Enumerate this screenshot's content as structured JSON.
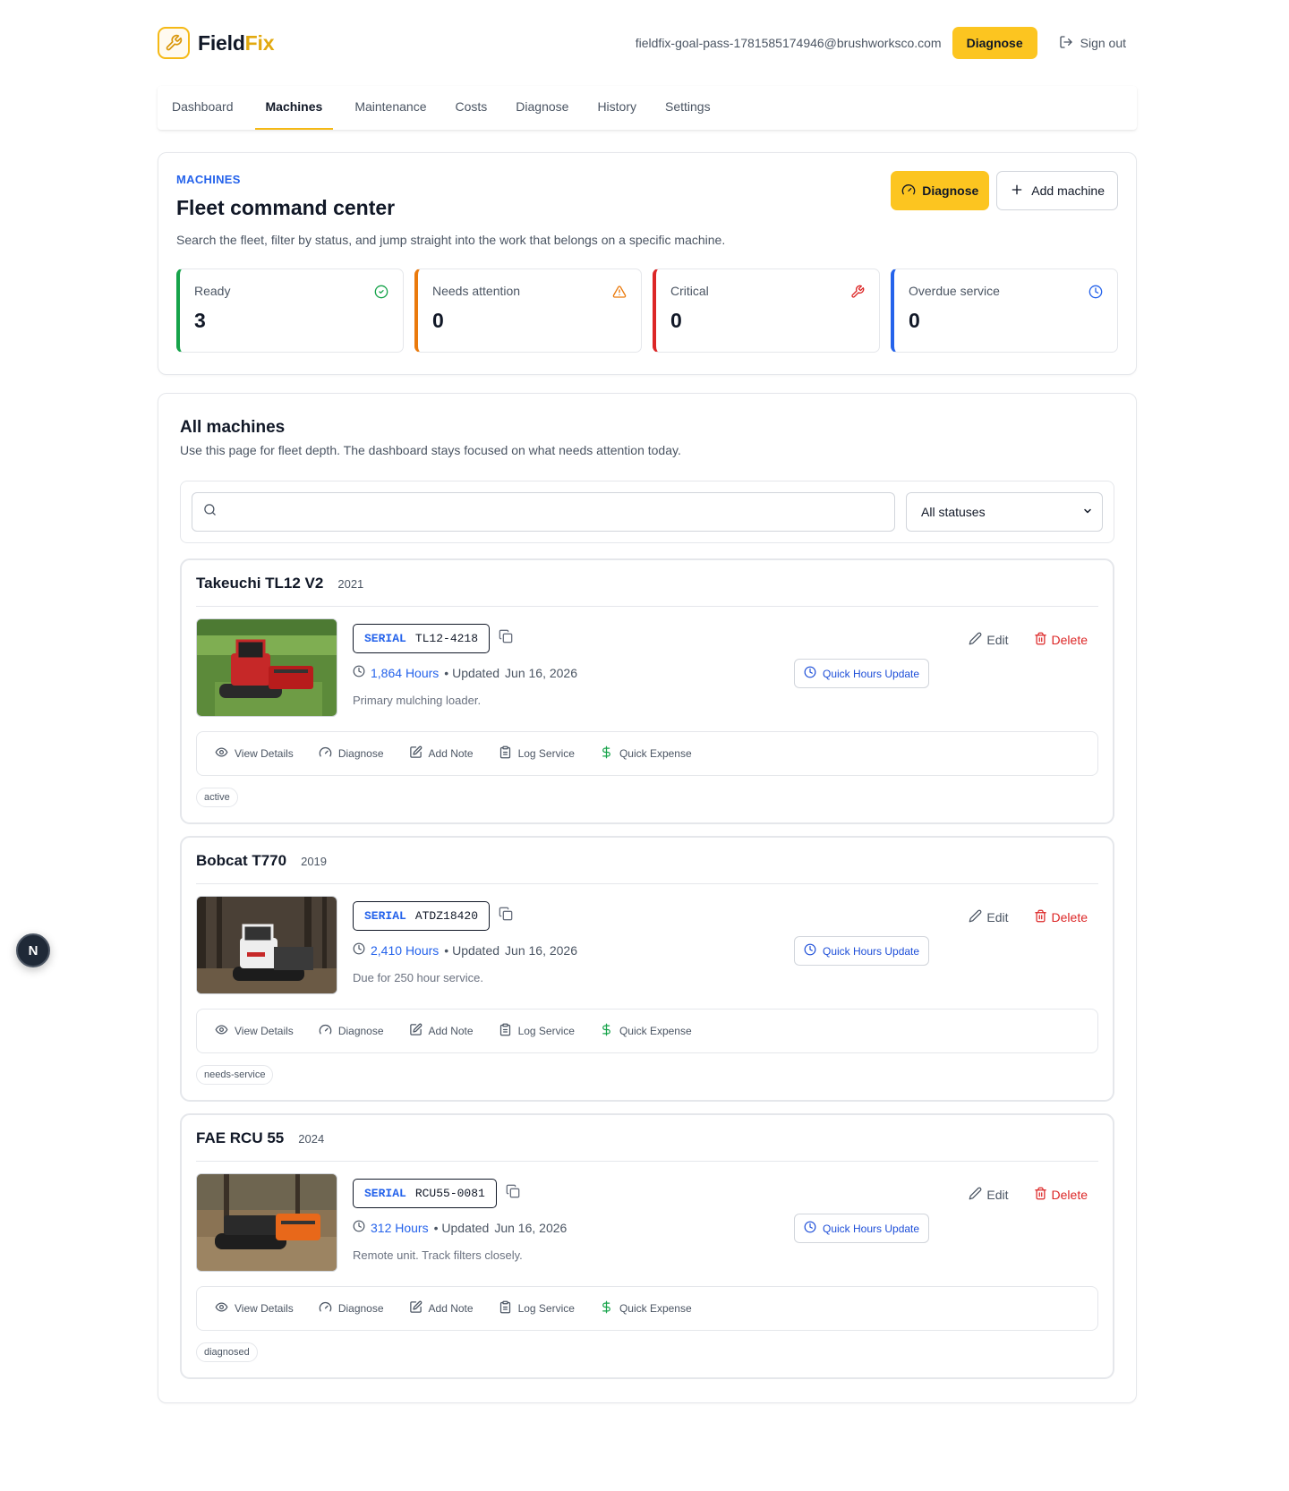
{
  "brand": {
    "name_main": "Field",
    "name_accent": "Fix"
  },
  "header": {
    "email": "fieldfix-goal-pass-1781585174946@brushworksco.com",
    "diagnose_label": "Diagnose",
    "signout_label": "Sign out"
  },
  "nav": {
    "items": [
      "Dashboard",
      "Machines",
      "Maintenance",
      "Costs",
      "Diagnose",
      "History",
      "Settings"
    ],
    "active": "Machines"
  },
  "hero": {
    "eyebrow": "MACHINES",
    "title": "Fleet command center",
    "subtitle": "Search the fleet, filter by status, and jump straight into the work that belongs on a specific machine.",
    "diagnose_label": "Diagnose",
    "add_label": "Add machine"
  },
  "stats": [
    {
      "label": "Ready",
      "value": "3",
      "color": "#16a34a"
    },
    {
      "label": "Needs attention",
      "value": "0",
      "color": "#ea7a0c"
    },
    {
      "label": "Critical",
      "value": "0",
      "color": "#dc2626"
    },
    {
      "label": "Overdue service",
      "value": "0",
      "color": "#2563eb"
    }
  ],
  "list": {
    "title": "All machines",
    "subtitle": "Use this page for fleet depth. The dashboard stays focused on what needs attention today.",
    "search_placeholder": "",
    "status_filter": "All statuses"
  },
  "quick_actions": [
    "View Details",
    "Diagnose",
    "Add Note",
    "Log Service",
    "Quick Expense"
  ],
  "machine_labels": {
    "serial_key": "SERIAL",
    "hours_suffix": "Hours",
    "updated_prefix": "• Updated",
    "quick_hours": "Quick Hours Update",
    "edit": "Edit",
    "delete": "Delete"
  },
  "machines": [
    {
      "name": "Takeuchi TL12 V2",
      "year": "2021",
      "serial": "TL12-4218",
      "hours": "1,864",
      "updated": "Jun 16, 2026",
      "note": "Primary mulching loader.",
      "tag": "active"
    },
    {
      "name": "Bobcat T770",
      "year": "2019",
      "serial": "ATDZ18420",
      "hours": "2,410",
      "updated": "Jun 16, 2026",
      "note": "Due for 250 hour service.",
      "tag": "needs-service"
    },
    {
      "name": "FAE RCU 55",
      "year": "2024",
      "serial": "RCU55-0081",
      "hours": "312",
      "updated": "Jun 16, 2026",
      "note": "Remote unit. Track filters closely.",
      "tag": "diagnosed"
    }
  ],
  "fab_label": "N"
}
